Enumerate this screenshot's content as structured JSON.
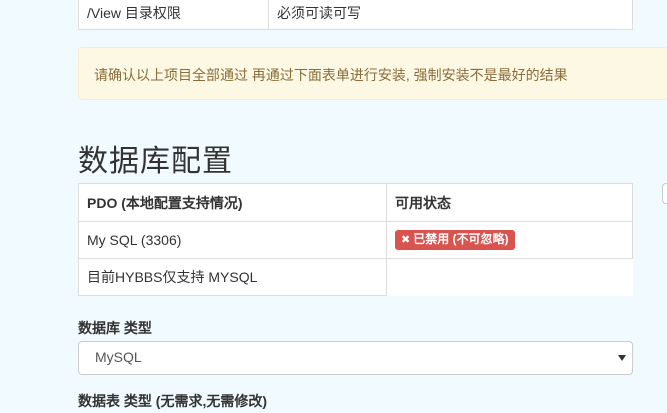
{
  "permission_table": {
    "rows": [
      {
        "path": "/View 目录权限",
        "requirement": "必须可读可写"
      }
    ]
  },
  "alert": {
    "text": "请确认以上项目全部通过 再通过下面表单进行安装, 强制安装不是最好的结果",
    "color": "#8a6d3b",
    "background": "#fcf8e3"
  },
  "section": {
    "title": "数据库配置"
  },
  "db_table": {
    "headers": [
      "PDO (本地配置支持情况)",
      "可用状态"
    ],
    "rows": [
      {
        "name": "My SQL (3306)",
        "status": "已禁用 (不可忽略)",
        "status_icon": "x-icon",
        "status_color": "#d9534f"
      },
      {
        "name": "目前HYBBS仅支持 MYSQL",
        "status": ""
      }
    ]
  },
  "form": {
    "db_type_label": "数据库 类型",
    "db_type_selected": "MySQL",
    "table_type_label": "数据表 类型 (无需求,无需修改)"
  }
}
